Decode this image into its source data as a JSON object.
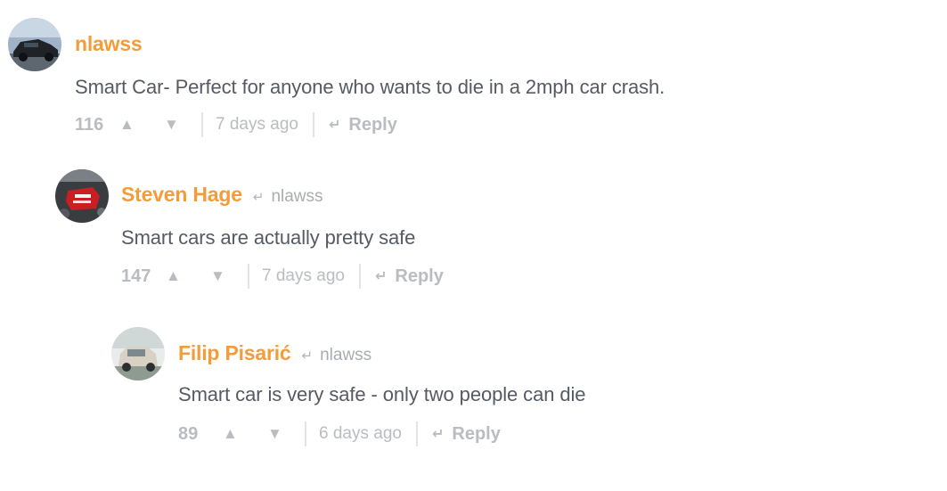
{
  "comments": [
    {
      "author": "nlawss",
      "reply_to": "",
      "text": "Smart Car- Perfect for anyone who wants to die in a 2mph car crash.",
      "score": "116",
      "time": "7 days ago",
      "reply_label": "Reply",
      "avatar": "car-photo-avatar"
    },
    {
      "author": "Steven Hage",
      "reply_to": "nlawss",
      "text": "Smart cars are actually pretty safe",
      "score": "147",
      "time": "7 days ago",
      "reply_label": "Reply",
      "avatar": "engine-photo-avatar"
    },
    {
      "author": "Filip Pisarić",
      "reply_to": "nlawss",
      "text": "Smart car is very safe - only two people can die",
      "score": "89",
      "time": "6 days ago",
      "reply_label": "Reply",
      "avatar": "hatchback-photo-avatar"
    }
  ],
  "icons": {
    "upvote": "▲",
    "downvote": "▼",
    "reply": "↵"
  },
  "colors": {
    "author": "#f39c3c",
    "text": "#555a63",
    "muted": "#b9bcc0"
  }
}
